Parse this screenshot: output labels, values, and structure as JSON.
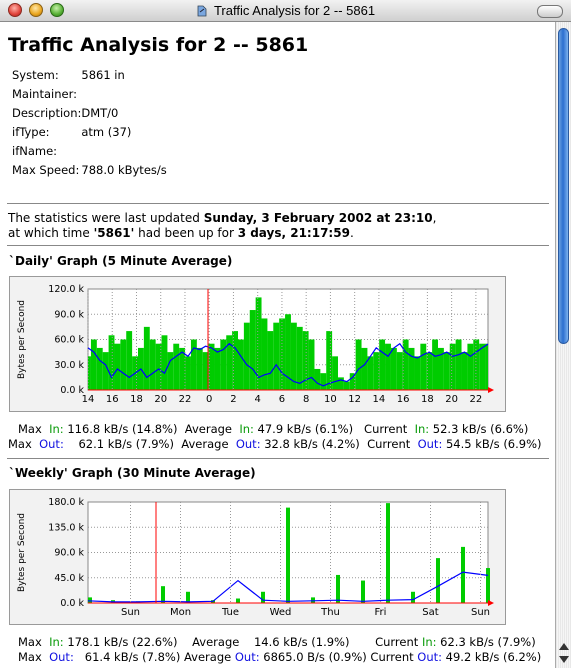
{
  "window": {
    "title": "Traffic Analysis for 2 -- 5861"
  },
  "page": {
    "heading": "Traffic Analysis for 2 -- 5861",
    "info": [
      {
        "key": "System:",
        "value": "5861 in"
      },
      {
        "key": "Maintainer:",
        "value": ""
      },
      {
        "key": "Description:",
        "value": "DMT/0"
      },
      {
        "key": "ifType:",
        "value": "atm (37)"
      },
      {
        "key": "ifName:",
        "value": ""
      },
      {
        "key": "Max Speed:",
        "value": "788.0 kBytes/s"
      }
    ],
    "stats": {
      "line1_prefix": "The statistics were last updated ",
      "line1_date": "Sunday, 3 February 2002 at 23:10",
      "line1_suffix": ",",
      "line2_prefix": "at which time ",
      "line2_device": "'5861'",
      "line2_mid": " had been up for ",
      "line2_uptime": "3 days, 21:17:59",
      "line2_suffix": "."
    }
  },
  "colors": {
    "in": "#00cc00",
    "out": "#0000ff",
    "marker": "#ff0000",
    "plot_bg": "#ffffff",
    "panel_bg": "#f2f2f2"
  },
  "graphs": [
    {
      "heading": "`Daily' Graph (5 Minute Average)",
      "ylabel": "Bytes per Second",
      "yticks": [
        "120.0 k",
        "90.0 k",
        "60.0 k",
        "30.0 k",
        "0.0 k"
      ],
      "xticks": [
        "14",
        "16",
        "18",
        "20",
        "22",
        "0",
        "2",
        "4",
        "6",
        "8",
        "10",
        "12",
        "14",
        "16",
        "18",
        "20",
        "22"
      ],
      "max": {
        "label": "Max",
        "in_label": "In:",
        "in_value": "116.8 kB/s (14.8%)",
        "out_label": "Out:",
        "out_value": "62.1 kB/s (7.9%)"
      },
      "avg": {
        "label": "Average",
        "in_label": "In:",
        "in_value": "47.9 kB/s (6.1%)",
        "out_label": "Out:",
        "out_value": "32.8 kB/s (4.2%)"
      },
      "cur": {
        "label": "Current",
        "in_label": "In:",
        "in_value": "52.3 kB/s (6.6%)",
        "out_label": "Out:",
        "out_value": "54.5 kB/s (6.9%)"
      }
    },
    {
      "heading": "`Weekly' Graph (30 Minute Average)",
      "ylabel": "Bytes per Second",
      "yticks": [
        "180.0 k",
        "135.0 k",
        "90.0 k",
        "45.0 k",
        "0.0 k"
      ],
      "xticks": [
        "Sun",
        "Mon",
        "Tue",
        "Wed",
        "Thu",
        "Fri",
        "Sat",
        "Sun"
      ],
      "max": {
        "label": "Max",
        "in_label": "In:",
        "in_value": "178.1 kB/s (22.6%)",
        "out_label": "Out:",
        "out_value": "61.4 kB/s (7.8%)"
      },
      "avg": {
        "label": "Average",
        "in_label": "In:",
        "in_value": "14.6 kB/s (1.9%)",
        "out_label": "Out:",
        "out_value": "6865.0 B/s (0.9%)"
      },
      "cur": {
        "label": "Current",
        "in_label": "In:",
        "in_value": "62.3 kB/s (7.9%)",
        "out_label": "Out:",
        "out_value": "49.2 kB/s (6.2%)"
      }
    }
  ],
  "chart_data": [
    {
      "type": "area",
      "title": "`Daily' Graph (5 Minute Average)",
      "ylabel": "Bytes per Second",
      "ylim": [
        0,
        120000
      ],
      "grid": true,
      "x": [
        13,
        13.5,
        14,
        14.5,
        15,
        15.5,
        16,
        16.5,
        17,
        17.5,
        18,
        18.5,
        19,
        19.5,
        20,
        20.5,
        21,
        21.5,
        22,
        22.5,
        23,
        23.5,
        24,
        24.5,
        25,
        25.5,
        26,
        26.5,
        27,
        27.5,
        28,
        28.5,
        29,
        29.5,
        30,
        30.5,
        31,
        31.5,
        32,
        32.5,
        33,
        33.5,
        34,
        34.5,
        35,
        35.5,
        36,
        36.5,
        37,
        37.5,
        38,
        38.5,
        39,
        39.5,
        40,
        40.5,
        41,
        41.5,
        42,
        42.5,
        43,
        43.5,
        44,
        44.5,
        45,
        45.5,
        46,
        46.5,
        47
      ],
      "series": [
        {
          "name": "In",
          "values": [
            40000,
            60000,
            50000,
            45000,
            65000,
            55000,
            60000,
            70000,
            40000,
            50000,
            75000,
            60000,
            55000,
            65000,
            45000,
            55000,
            50000,
            40000,
            60000,
            50000,
            45000,
            55000,
            50000,
            60000,
            65000,
            70000,
            60000,
            80000,
            95000,
            110000,
            85000,
            70000,
            80000,
            85000,
            90000,
            80000,
            75000,
            70000,
            60000,
            25000,
            20000,
            70000,
            40000,
            15000,
            10000,
            20000,
            60000,
            50000,
            40000,
            45000,
            60000,
            55000,
            50000,
            45000,
            60000,
            50000,
            40000,
            55000,
            45000,
            60000,
            50000,
            45000,
            55000,
            60000,
            45000,
            55000,
            60000,
            55000,
            55000
          ]
        },
        {
          "name": "Out",
          "values": [
            50000,
            45000,
            35000,
            30000,
            15000,
            25000,
            20000,
            15000,
            20000,
            25000,
            15000,
            20000,
            25000,
            20000,
            35000,
            40000,
            45000,
            40000,
            50000,
            48000,
            52000,
            50000,
            45000,
            48000,
            55000,
            50000,
            40000,
            30000,
            25000,
            15000,
            18000,
            20000,
            30000,
            20000,
            15000,
            10000,
            8000,
            12000,
            15000,
            8000,
            5000,
            8000,
            10000,
            12000,
            10000,
            15000,
            25000,
            30000,
            40000,
            50000,
            45000,
            40000,
            50000,
            55000,
            45000,
            40000,
            38000,
            42000,
            45000,
            40000,
            42000,
            45000,
            40000,
            42000,
            45000,
            40000,
            45000,
            50000,
            54500
          ]
        }
      ]
    },
    {
      "type": "area",
      "title": "`Weekly' Graph (30 Minute Average)",
      "ylabel": "Bytes per Second",
      "ylim": [
        0,
        180000
      ],
      "grid": true,
      "x": [
        "Sun",
        "Mon",
        "Tue",
        "Wed",
        "Thu",
        "Fri",
        "Sat",
        "Sun"
      ],
      "series": [
        {
          "name": "In",
          "values": [
            10000,
            5000,
            3000,
            30000,
            20000,
            5000,
            8000,
            20000,
            170000,
            10000,
            50000,
            40000,
            178000,
            20000,
            80000,
            100000,
            62300
          ]
        },
        {
          "name": "Out",
          "values": [
            4000,
            2000,
            2000,
            3000,
            2000,
            3000,
            40000,
            5000,
            3000,
            4000,
            5000,
            3000,
            5000,
            6000,
            30000,
            55000,
            49200
          ]
        }
      ]
    }
  ]
}
